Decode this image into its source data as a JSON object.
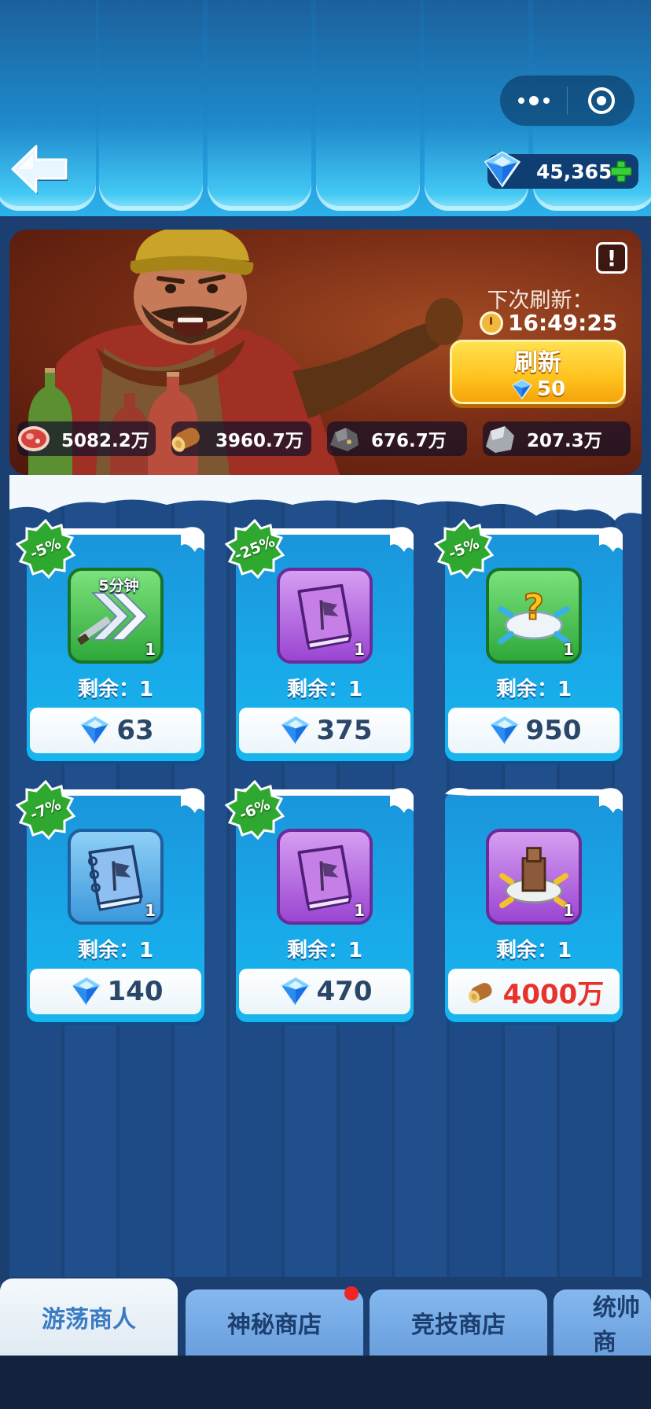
{
  "header": {
    "gems": "45,365"
  },
  "banner": {
    "refresh_label": "下次刷新：",
    "refresh_time": "16:49:25",
    "refresh_button": "刷新",
    "refresh_cost": "50",
    "resources": [
      {
        "icon": "meat-icon",
        "value": "5082.2万"
      },
      {
        "icon": "wood-log-icon",
        "value": "3960.7万"
      },
      {
        "icon": "ore-icon",
        "value": "676.7万"
      },
      {
        "icon": "stone-icon",
        "value": "207.3万"
      }
    ]
  },
  "shop": {
    "items": [
      {
        "discount": "-5%",
        "icon": "speedup-arrow-icon",
        "time_tag": "5分钟",
        "qty": "1",
        "remain": "剩余：1",
        "currency": "gem-icon",
        "price": "63"
      },
      {
        "discount": "-25%",
        "icon": "purple-flag-book-icon",
        "qty": "1",
        "remain": "剩余：1",
        "currency": "gem-icon",
        "price": "375"
      },
      {
        "discount": "-5%",
        "icon": "mystery-relocate-icon",
        "qty": "1",
        "remain": "剩余：1",
        "currency": "gem-icon",
        "price": "950"
      },
      {
        "discount": "-7%",
        "icon": "blue-flag-book-icon",
        "qty": "1",
        "remain": "剩余：1",
        "currency": "gem-icon",
        "price": "140"
      },
      {
        "discount": "-6%",
        "icon": "purple-flag-book-icon",
        "qty": "1",
        "remain": "剩余：1",
        "currency": "gem-icon",
        "price": "470"
      },
      {
        "discount": "",
        "icon": "fortress-relocate-icon",
        "qty": "1",
        "remain": "剩余：1",
        "currency": "wood-log-icon",
        "price": "4000万"
      }
    ]
  },
  "tabs": [
    {
      "label": "游荡商人",
      "active": true
    },
    {
      "label": "神秘商店",
      "notify": true
    },
    {
      "label": "竞技商店"
    },
    {
      "label": "统帅商"
    }
  ],
  "colors": {
    "discount_badge": "#2fa82f",
    "price_text": "#2b4768",
    "price_red": "#e8322b",
    "refresh_button": "#ffc21f"
  }
}
